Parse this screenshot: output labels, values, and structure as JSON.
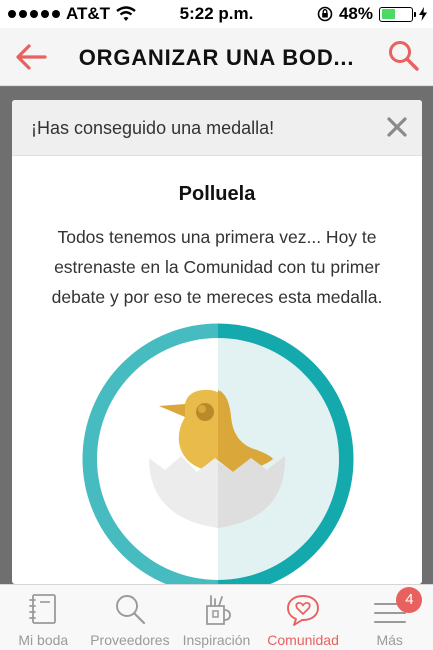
{
  "status_bar": {
    "carrier": "AT&T",
    "time": "5:22 p.m.",
    "battery_percent": "48%",
    "battery_level": 0.48
  },
  "header": {
    "title": "ORGANIZAR UNA BOD..."
  },
  "modal": {
    "header_text": "¡Has conseguido una medalla!",
    "badge_title": "Polluela",
    "description": "Todos tenemos una primera vez... Hoy te estrenaste en la Comunidad con tu primer debate y por eso te mereces esta medalla."
  },
  "tabs": [
    {
      "label": "Mi boda",
      "icon": "notebook-icon",
      "active": false
    },
    {
      "label": "Proveedores",
      "icon": "search-icon",
      "active": false
    },
    {
      "label": "Inspiración",
      "icon": "cup-icon",
      "active": false
    },
    {
      "label": "Comunidad",
      "icon": "heart-chat-icon",
      "active": true
    },
    {
      "label": "Más",
      "icon": "menu-icon",
      "active": false,
      "badge": "4"
    }
  ],
  "colors": {
    "accent": "#e8615e",
    "medal_ring": "#1fb0b4",
    "chick": "#e9bb4a"
  }
}
